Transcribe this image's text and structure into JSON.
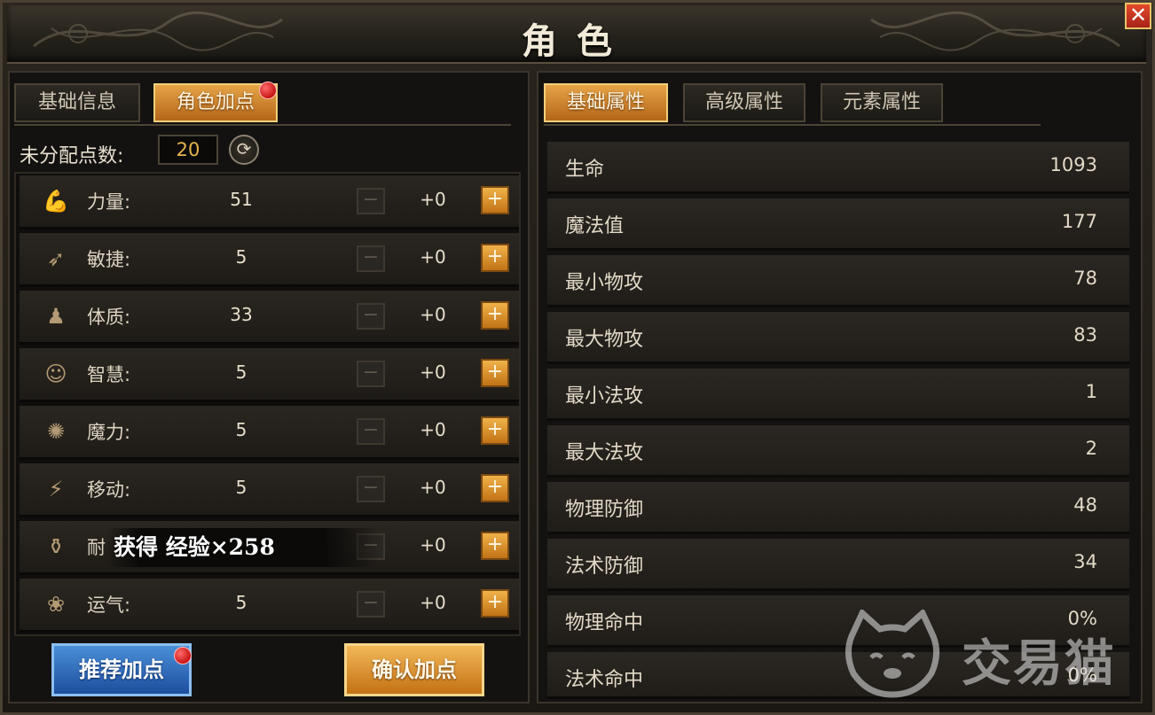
{
  "window": {
    "title": "角色",
    "close_label": "✕"
  },
  "left_tabs": [
    {
      "label": "基础信息",
      "active": false
    },
    {
      "label": "角色加点",
      "active": true,
      "has_badge": true
    }
  ],
  "points": {
    "unallocated_label": "未分配点数:",
    "unallocated_value": "20"
  },
  "stats": [
    {
      "icon": "strength-icon",
      "label": "力量:",
      "value": "51",
      "bonus": "+0"
    },
    {
      "icon": "agility-icon",
      "label": "敏捷:",
      "value": "5",
      "bonus": "+0"
    },
    {
      "icon": "constitution-icon",
      "label": "体质:",
      "value": "33",
      "bonus": "+0"
    },
    {
      "icon": "wisdom-icon",
      "label": "智慧:",
      "value": "5",
      "bonus": "+0"
    },
    {
      "icon": "magic-icon",
      "label": "魔力:",
      "value": "5",
      "bonus": "+0"
    },
    {
      "icon": "movement-icon",
      "label": "移动:",
      "value": "5",
      "bonus": "+0"
    },
    {
      "icon": "endurance-icon",
      "label": "耐",
      "value": "",
      "bonus": "+0"
    },
    {
      "icon": "luck-icon",
      "label": "运气:",
      "value": "5",
      "bonus": "+0"
    }
  ],
  "toast": {
    "text": "获得 经验×258"
  },
  "buttons": {
    "recommend_label": "推荐加点",
    "confirm_label": "确认加点"
  },
  "right_tabs": [
    {
      "label": "基础属性",
      "active": true
    },
    {
      "label": "高级属性",
      "active": false
    },
    {
      "label": "元素属性",
      "active": false
    }
  ],
  "attributes": [
    {
      "name": "生命",
      "value": "1093"
    },
    {
      "name": "魔法值",
      "value": "177"
    },
    {
      "name": "最小物攻",
      "value": "78"
    },
    {
      "name": "最大物攻",
      "value": "83"
    },
    {
      "name": "最小法攻",
      "value": "1"
    },
    {
      "name": "最大法攻",
      "value": "2"
    },
    {
      "name": "物理防御",
      "value": "48"
    },
    {
      "name": "法术防御",
      "value": "34"
    },
    {
      "name": "物理命中",
      "value": "0%"
    },
    {
      "name": "法术命中",
      "value": "0%"
    }
  ],
  "watermark": {
    "text": "交易猫"
  },
  "colors": {
    "accent_gold": "#e6a447",
    "accent_blue": "#2f6cc0",
    "badge_red": "#c91414"
  }
}
